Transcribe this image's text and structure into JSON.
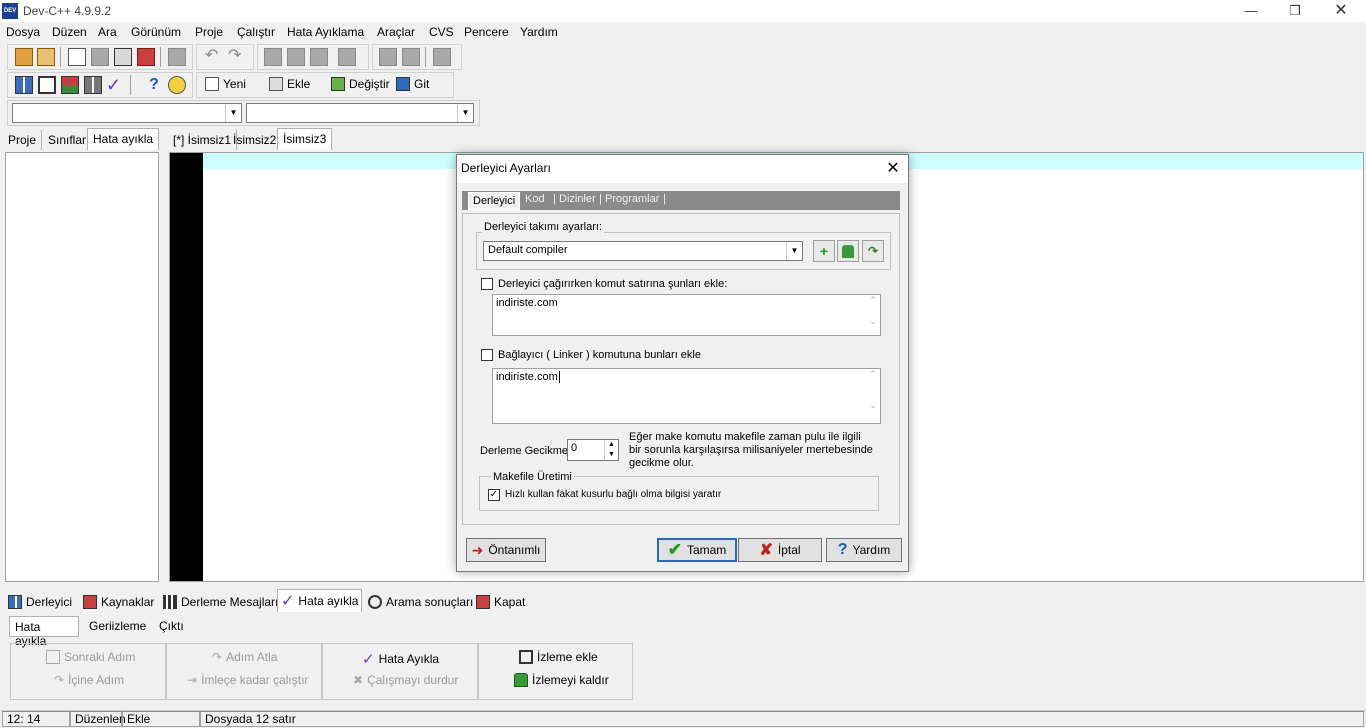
{
  "window": {
    "title": "Dev-C++ 4.9.9.2",
    "app_icon_text": "DEV"
  },
  "menu": [
    "Dosya",
    "Düzen",
    "Ara",
    "Görünüm",
    "Proje",
    "Çalıştır",
    "Hata Ayıklama",
    "Araçlar",
    "CVS",
    "Pencere",
    "Yardım"
  ],
  "toolbar2": {
    "new": "Yeni",
    "insert": "Ekle",
    "toggle": "Değiştir",
    "goto": "Git"
  },
  "left_tabs": [
    "Proje",
    "Sınıflar",
    "Hata ayıkla"
  ],
  "editor_tabs": [
    "[*] İsimsiz1",
    "İsimsiz2",
    "İsimsiz3"
  ],
  "bottom_tabs": [
    "Derleyici",
    "Kaynaklar",
    "Derleme Mesajları",
    "Hata ayıkla",
    "Arama sonuçları",
    "Kapat"
  ],
  "debug_subtabs": [
    "Hata ayıkla",
    "Geriizleme",
    "Çıktı"
  ],
  "debug_buttons": {
    "next_step": "Sonraki Adım",
    "skip_step": "Adım Atla",
    "debug": "Hata Ayıkla",
    "add_watch": "İzleme ekle",
    "step_into": "İçine Adım",
    "run_to_cursor": "İmleçe kadar çalıştır",
    "stop_execution": "Çalışmayı durdur",
    "remove_watch": "İzlemeyi kaldır"
  },
  "status": {
    "position": "12: 14",
    "mode": "Düzenlen",
    "insert": "Ekle",
    "lines": "Dosyada 12 satır"
  },
  "dialog": {
    "title": "Derleyici Ayarları",
    "tabs": [
      "Derleyici",
      "Kod",
      "Dizinler",
      "Programlar"
    ],
    "compiler_set_label": "Derleyici takımı ayarları:",
    "compiler_set_value": "Default compiler",
    "add_cmd_label": "Derleyici çağırırken komut satırına şunları ekle:",
    "add_cmd_value": "indiriste.com",
    "add_cmd_checked": false,
    "linker_label": "Bağlayıcı ( Linker ) komutuna bunları ekle",
    "linker_value": "indiriste.com",
    "linker_checked": false,
    "delay_label": "Derleme Gecikmesi:",
    "delay_value": "0",
    "delay_note": "Eğer make komutu makefile zaman pulu ile ilgili bir sorunla karşılaşırsa milisaniyeler mertebesinde gecikme olur.",
    "makefile_label": "Makefile Üretimi",
    "makefile_option": "Hızlı kullan fakat kusurlu bağlı olma bilgisi yaratır",
    "makefile_checked": true,
    "btn_default": "Öntanımlı",
    "btn_ok": "Tamam",
    "btn_cancel": "İptal",
    "btn_help": "Yardım"
  }
}
